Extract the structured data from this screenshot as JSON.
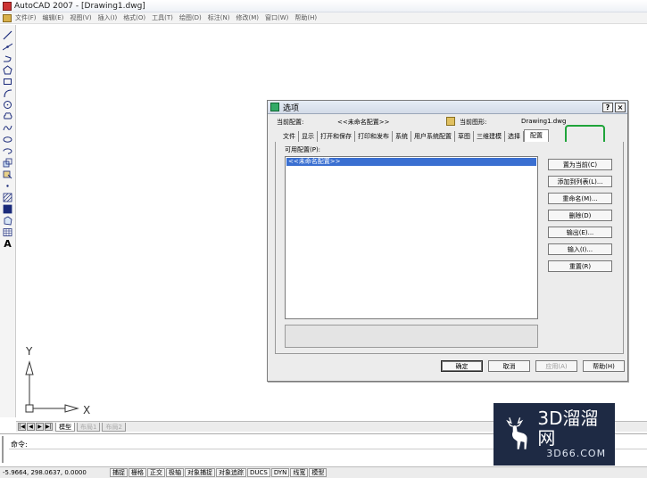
{
  "window": {
    "title": "AutoCAD 2007 - [Drawing1.dwg]"
  },
  "menu": {
    "items": [
      "文件(F)",
      "编辑(E)",
      "视图(V)",
      "插入(I)",
      "格式(O)",
      "工具(T)",
      "绘图(D)",
      "标注(N)",
      "修改(M)",
      "窗口(W)",
      "帮助(H)"
    ]
  },
  "toolbar": {
    "text_tool": "A"
  },
  "ucs": {
    "x_label": "X",
    "y_label": "Y"
  },
  "layout_tabs": {
    "nav": [
      "|◀",
      "◀",
      "▶",
      "▶|"
    ],
    "model": "模型",
    "layout1": "布局1",
    "layout2": "布局2"
  },
  "command": {
    "prompt": "命令:"
  },
  "status": {
    "coords": "-5.9664,  298.0637, 0.0000",
    "buttons": [
      "捕捉",
      "栅格",
      "正交",
      "极轴",
      "对象捕捉",
      "对象追踪",
      "DUCS",
      "DYN",
      "线宽",
      "模型"
    ]
  },
  "watermark": {
    "main": "3D溜溜网",
    "sub": "3D66.COM"
  },
  "dialog": {
    "title": "选项",
    "help": "?",
    "close": "×",
    "current_profile_label": "当前配置:",
    "current_profile_value": "<<未命名配置>>",
    "current_drawing_label": "当前图形:",
    "current_drawing_value": "Drawing1.dwg",
    "tabs": [
      "文件",
      "显示",
      "打开和保存",
      "打印和发布",
      "系统",
      "用户系统配置",
      "草图",
      "三维建模",
      "选择",
      "配置"
    ],
    "available_label": "可用配置(P):",
    "profiles": [
      "<<未命名配置>>"
    ],
    "side_buttons": [
      "置为当前(C)",
      "添加到列表(L)...",
      "重命名(M)...",
      "删除(D)",
      "输出(E)...",
      "输入(I)...",
      "重置(R)"
    ],
    "bottom_buttons": {
      "ok": "确定",
      "cancel": "取消",
      "apply": "应用(A)",
      "help": "帮助(H)"
    }
  }
}
